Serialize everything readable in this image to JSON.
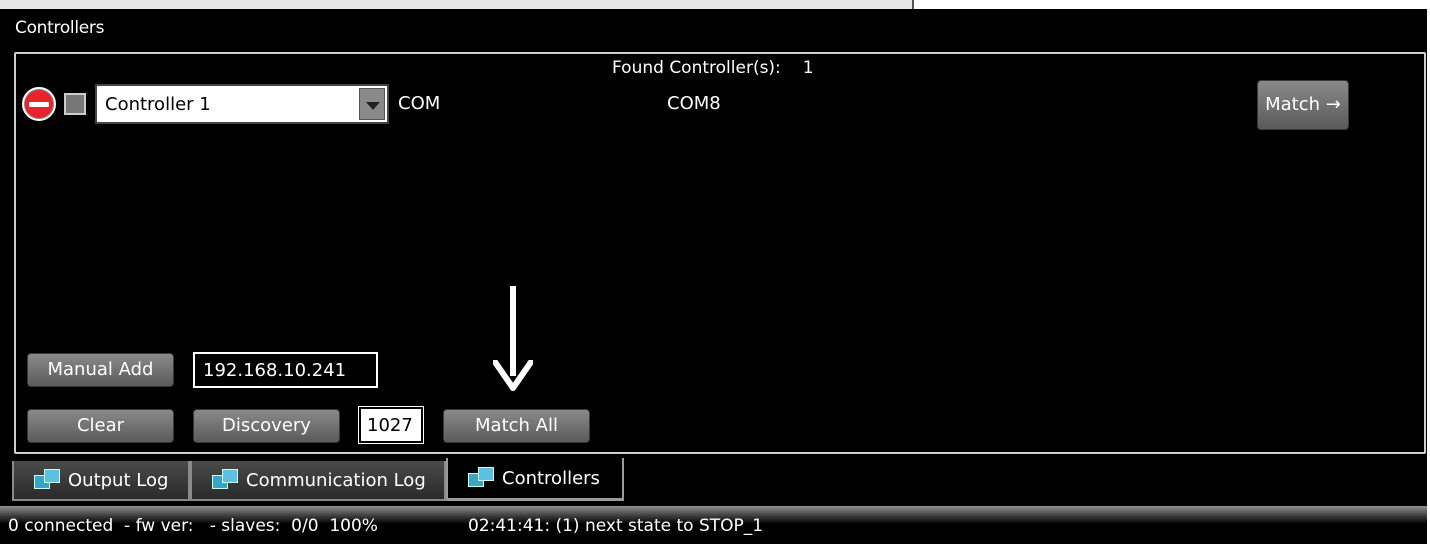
{
  "panel": {
    "title": "Controllers",
    "found_label": "Found Controller(s):",
    "found_count": "1"
  },
  "controller_row": {
    "name": "Controller 1",
    "connection_type": "COM",
    "port": "COM8",
    "match_label": "Match →"
  },
  "controls": {
    "manual_add_label": "Manual Add",
    "ip_value": "192.168.10.241",
    "clear_label": "Clear",
    "discovery_label": "Discovery",
    "port_value": "1027",
    "match_all_label": "Match All"
  },
  "tabs": [
    {
      "label": "Output Log",
      "active": false
    },
    {
      "label": "Communication Log",
      "active": false
    },
    {
      "label": "Controllers",
      "active": true
    }
  ],
  "status": {
    "left": "0 connected  - fw ver:   - slaves:  0/0  100%",
    "right": "02:41:41: (1) next state to STOP_1"
  },
  "colors": {
    "remove_icon": "#e8232a",
    "tab_icon": "#3aa3c8"
  }
}
